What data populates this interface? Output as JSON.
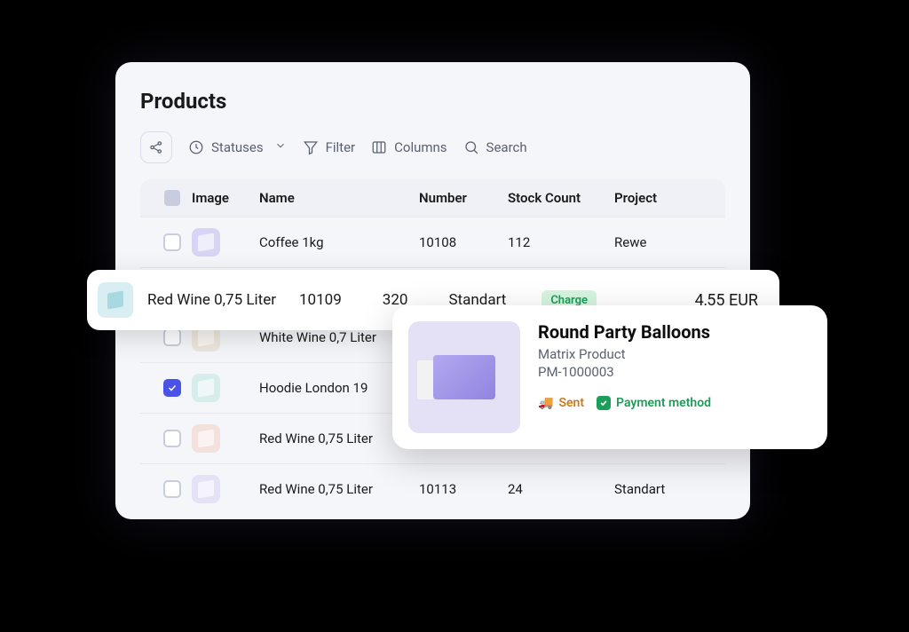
{
  "page": {
    "title": "Products"
  },
  "toolbar": {
    "statuses_label": "Statuses",
    "filter_label": "Filter",
    "columns_label": "Columns",
    "search_label": "Search"
  },
  "table": {
    "headers": {
      "image": "Image",
      "name": "Name",
      "number": "Number",
      "stock": "Stock Count",
      "project": "Project"
    },
    "rows": [
      {
        "name": "Coffee 1kg",
        "number": "10108",
        "stock": "112",
        "project": "Rewe",
        "checked": false,
        "thumb": "thumb-purple"
      },
      {
        "name": "White Wine 0,7 Liter",
        "number": "",
        "stock": "",
        "project": "",
        "checked": false,
        "thumb": "thumb-beige"
      },
      {
        "name": "Hoodie London 19",
        "number": "",
        "stock": "",
        "project": "",
        "checked": true,
        "thumb": "thumb-teal"
      },
      {
        "name": "Red Wine 0,75 Liter",
        "number": "",
        "stock": "",
        "project": "",
        "checked": false,
        "thumb": "thumb-pink"
      },
      {
        "name": "Red Wine 0,75 Liter",
        "number": "10113",
        "stock": "24",
        "project": "Standart",
        "checked": false,
        "thumb": "thumb-lav"
      }
    ]
  },
  "highlighted_row": {
    "name": "Red Wine 0,75 Liter",
    "number": "10109",
    "stock": "320",
    "project": "Standart",
    "badge": "Charge",
    "price": "4,55 EUR"
  },
  "product_card": {
    "title": "Round Party Balloons",
    "subtitle": "Matrix Product",
    "sku": "PM-1000003",
    "badge_sent": "Sent",
    "badge_payment": "Payment method"
  }
}
